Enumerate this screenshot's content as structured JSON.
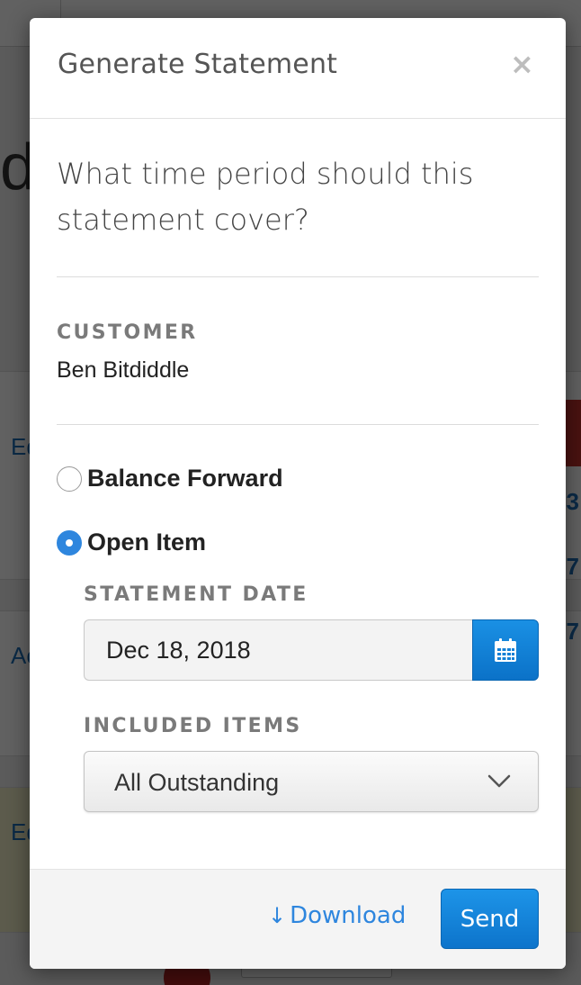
{
  "background": {
    "headline_fragment": "d",
    "links": [
      "Ed",
      "Ac",
      "Ed"
    ],
    "numbers": [
      "3",
      "7",
      "7"
    ]
  },
  "modal": {
    "title": "Generate Statement",
    "close_symbol": "×",
    "question": "What time period should this statement cover?",
    "customer": {
      "label": "CUSTOMER",
      "name": "Ben Bitdiddle"
    },
    "statement_type": {
      "options": [
        {
          "label": "Balance Forward",
          "selected": false
        },
        {
          "label": "Open Item",
          "selected": true
        }
      ]
    },
    "statement_date": {
      "label": "STATEMENT DATE",
      "value": "Dec 18, 2018",
      "calendar_icon": "calendar-icon"
    },
    "included_items": {
      "label": "INCLUDED ITEMS",
      "selected": "All Outstanding",
      "chevron_icon": "chevron-down-icon"
    },
    "footer": {
      "download_arrow": "↓",
      "download_label": "Download",
      "send_label": "Send"
    }
  },
  "colors": {
    "accent": "#2e86de",
    "primary_button": "#0d74cb",
    "overlay": "rgba(0,0,0,0.62)"
  }
}
